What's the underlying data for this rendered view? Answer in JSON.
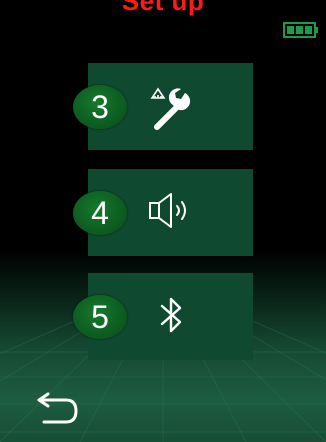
{
  "header": {
    "title": "Set up"
  },
  "status": {
    "battery_icon": "battery-full-icon"
  },
  "menu": {
    "items": [
      {
        "number": "3",
        "icon": "wrench-ruler-icon"
      },
      {
        "number": "4",
        "icon": "speaker-icon"
      },
      {
        "number": "5",
        "icon": "bluetooth-icon"
      }
    ]
  },
  "footer": {
    "back_icon": "back-arrow-icon"
  },
  "colors": {
    "title": "#ff1a1a",
    "tile": "#0f4a30",
    "badge": "#0d5d21",
    "icon": "#ffffff"
  }
}
